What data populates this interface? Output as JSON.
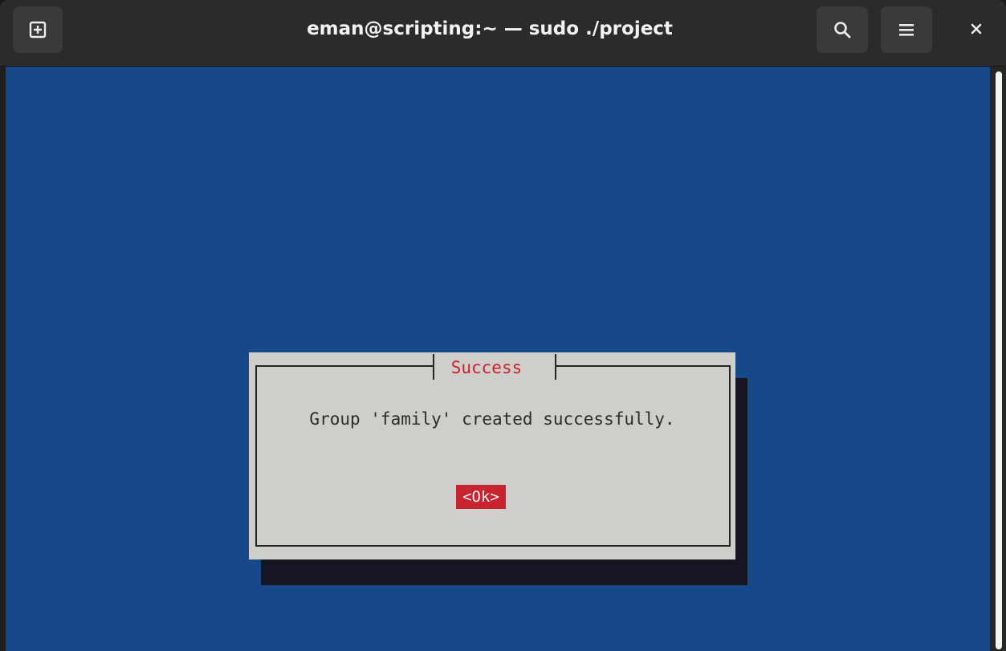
{
  "window": {
    "title": "eman@scripting:~ — sudo ./project"
  },
  "toolbar": {
    "new_tab_icon": "new-tab-icon",
    "search_icon": "search-icon",
    "menu_icon": "hamburger-menu-icon",
    "close_icon": "close-icon"
  },
  "dialog": {
    "title": "Success",
    "message": "Group 'family' created successfully.",
    "ok_label": "<Ok>"
  },
  "colors": {
    "terminal_background": "#16488a",
    "dialog_background": "#d0ceca",
    "accent_red": "#c8232f",
    "titlebar": "#2b2b2b"
  }
}
